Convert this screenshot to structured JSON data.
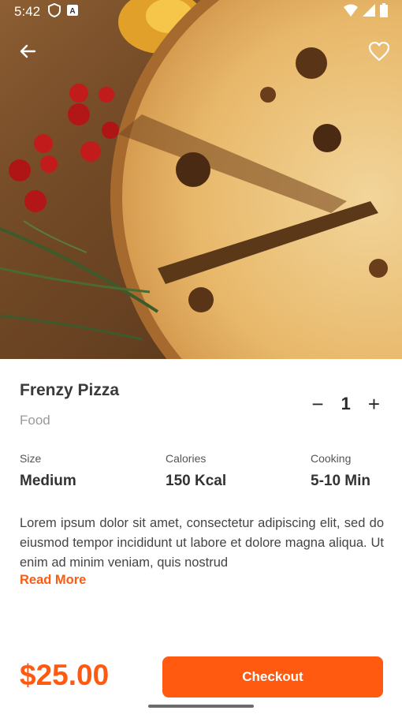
{
  "status_bar": {
    "time": "5:42",
    "left_icons": [
      "shield-icon",
      "a-box-icon"
    ],
    "right_icons": [
      "wifi-icon",
      "signal-icon",
      "battery-icon"
    ]
  },
  "header": {
    "back_icon": "arrow-left-icon",
    "favorite_icon": "heart-outline-icon"
  },
  "product": {
    "title": "Frenzy Pizza",
    "category": "Food",
    "quantity": "1",
    "minus": "−",
    "plus": "+"
  },
  "stats": [
    {
      "label": "Size",
      "value": "Medium"
    },
    {
      "label": "Calories",
      "value": "150 Kcal"
    },
    {
      "label": "Cooking",
      "value": "5-10 Min"
    }
  ],
  "description": "Lorem ipsum dolor sit amet, consectetur adipiscing elit, sed do eiusmod tempor incididunt ut labore et dolore magna aliqua. Ut enim ad minim veniam, quis nostrud",
  "read_more": "Read More",
  "footer": {
    "price": "$25.00",
    "checkout_label": "Checkout"
  },
  "colors": {
    "accent": "#ff5a10",
    "title": "#3a3a3a",
    "muted": "#9a9a9a"
  }
}
